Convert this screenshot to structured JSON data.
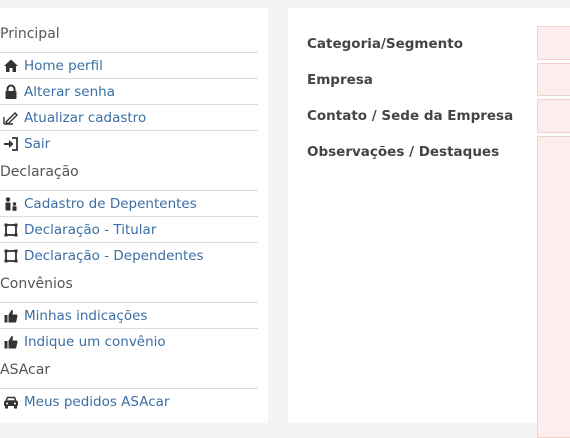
{
  "sidebar": {
    "sections": [
      {
        "title": "Principal",
        "items": [
          {
            "label": "Home perfil",
            "icon": "home-icon"
          },
          {
            "label": "Alterar senha",
            "icon": "lock-icon"
          },
          {
            "label": "Atualizar cadastro",
            "icon": "edit-icon"
          },
          {
            "label": "Sair",
            "icon": "sign-out-icon"
          }
        ]
      },
      {
        "title": "Declaração",
        "items": [
          {
            "label": "Cadastro de Depententes",
            "icon": "family-icon"
          },
          {
            "label": "Declaração - Titular",
            "icon": "document-icon"
          },
          {
            "label": "Declaração - Dependentes",
            "icon": "document-icon"
          }
        ]
      },
      {
        "title": "Convênios",
        "items": [
          {
            "label": "Minhas indicações",
            "icon": "thumbs-up-icon"
          },
          {
            "label": "Indique um convênio",
            "icon": "thumbs-up-icon"
          }
        ]
      },
      {
        "title": "ASAcar",
        "items": [
          {
            "label": "Meus pedidos ASAcar",
            "icon": "car-icon"
          }
        ]
      }
    ]
  },
  "form": {
    "fields": [
      {
        "label": "Categoria/Segmento",
        "value": ""
      },
      {
        "label": "Empresa",
        "value": ""
      },
      {
        "label": "Contato / Sede da Empresa",
        "value": ""
      },
      {
        "label": "Observações / Destaques",
        "value": ""
      }
    ]
  },
  "colors": {
    "link": "#3a6ea5",
    "field_background": "#fdeeed"
  }
}
